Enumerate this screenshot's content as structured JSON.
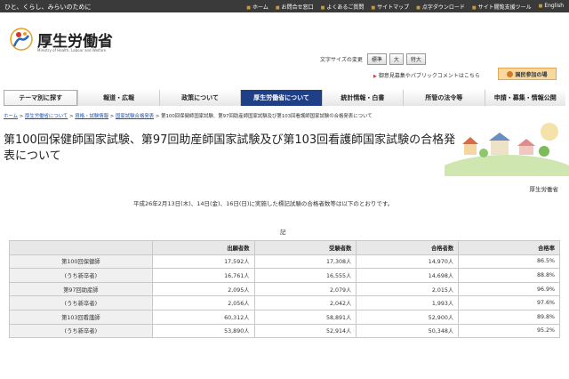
{
  "topbar": {
    "tagline": "ひと、くらし、みらいのために",
    "links": [
      "ホーム",
      "お問合せ窓口",
      "よくあるご質問",
      "サイトマップ",
      "点字ダウンロード",
      "サイト閲覧支援ツール",
      "English"
    ]
  },
  "header": {
    "logo_text": "厚生労働省",
    "logo_sub": "Ministry of Health, Labour and Welfare",
    "fontsize_label": "文字サイズの変更",
    "fontsize_buttons": [
      "標準",
      "大",
      "特大"
    ],
    "opinion_link": "御意見募集やパブリックコメントはこちら",
    "public_button": "国民参加の場"
  },
  "nav": {
    "items": [
      "テーマ別に探す",
      "報道・広報",
      "政策について",
      "厚生労働省について",
      "統計情報・白書",
      "所管の法令等",
      "申請・募集・情報公開"
    ]
  },
  "breadcrumb": {
    "links": [
      "ホーム",
      "厚生労働省について",
      "資格・試験情報",
      "国家試験合格発表"
    ],
    "current": "第100回保健師国家試験、第97回助産師国家試験及び第103回看護師国家試験の合格発表について"
  },
  "page": {
    "title": "第100回保健師国家試験、第97回助産師国家試験及び第103回看護師国家試験の合格発表について",
    "ministry": "厚生労働省",
    "intro": "平成26年2月13日(木)、14日(金)、16日(日)に実施した標記試験の合格者数等は以下のとおりです。",
    "ki": "記"
  },
  "table": {
    "headers": [
      "",
      "出願者数",
      "受験者数",
      "合格者数",
      "合格率"
    ],
    "rows": [
      [
        "第100回保健師",
        "17,592人",
        "17,308人",
        "14,970人",
        "86.5%"
      ],
      [
        "(うち新卒者)",
        "16,761人",
        "16,555人",
        "14,698人",
        "88.8%"
      ],
      [
        "第97回助産師",
        "2,095人",
        "2,079人",
        "2,015人",
        "96.9%"
      ],
      [
        "(うち新卒者)",
        "2,056人",
        "2,042人",
        "1,993人",
        "97.6%"
      ],
      [
        "第103回看護師",
        "60,312人",
        "58,891人",
        "52,900人",
        "89.8%"
      ],
      [
        "(うち新卒者)",
        "53,890人",
        "52,914人",
        "50,348人",
        "95.2%"
      ]
    ]
  },
  "colors": {
    "nav_active": "#1f3f86",
    "topbar": "#3a3a3a",
    "link": "#2255aa"
  }
}
